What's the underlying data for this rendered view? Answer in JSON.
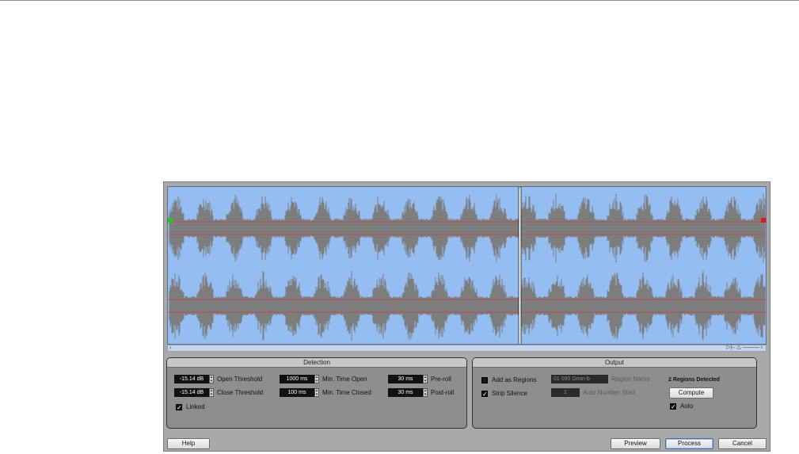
{
  "detection": {
    "title": "Detection",
    "open_threshold": {
      "value": "-15.14 dB",
      "label": "Open Threshold"
    },
    "close_threshold": {
      "value": "-15.14 dB",
      "label": "Close Threshold"
    },
    "min_time_open": {
      "value": "1000 ms",
      "label": "Min. Time Open"
    },
    "min_time_closed": {
      "value": "100 ms",
      "label": "Min. Time Closed"
    },
    "pre_roll": {
      "value": "30 ms",
      "label": "Pre-roll"
    },
    "post_roll": {
      "value": "30 ms",
      "label": "Post-roll"
    },
    "linked": {
      "label": "Linked",
      "checked": true
    }
  },
  "output": {
    "title": "Output",
    "add_as_regions": {
      "label": "Add as Regions",
      "checked": false
    },
    "strip_silence": {
      "label": "Strip Silence",
      "checked": true
    },
    "region_name": {
      "value": "01 090 Dmin-b",
      "label": "Region Name"
    },
    "auto_number_start": {
      "value": "1",
      "label": "Auto Number Start"
    },
    "regions_detected": "2 Regions Detected",
    "compute_label": "Compute",
    "auto": {
      "label": "Auto",
      "checked": true
    }
  },
  "buttons": {
    "help": "Help",
    "preview": "Preview",
    "process": "Process",
    "cancel": "Cancel"
  },
  "colors": {
    "waveform_bg": "#94bdf2",
    "waveform": "#7d7d7d",
    "threshold_line": "#d23b3b",
    "start_marker": "#27c427",
    "end_marker": "#e01818"
  }
}
